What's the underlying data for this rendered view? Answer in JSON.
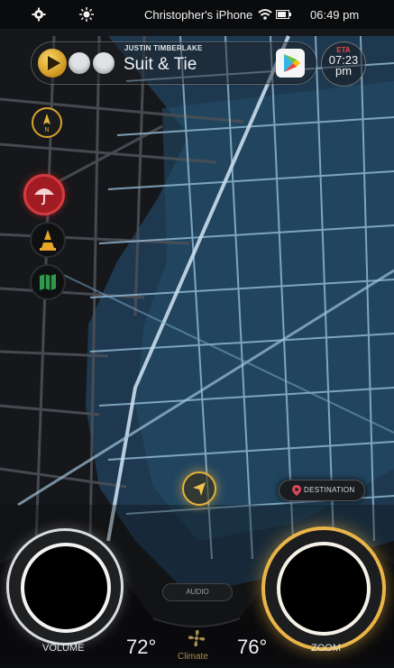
{
  "status_bar": {
    "device": "Christopher's iPhone",
    "time": "06:49 pm",
    "icons": [
      "gear-icon",
      "brightness-icon",
      "wifi-icon",
      "battery-icon"
    ]
  },
  "now_playing": {
    "artist": "JUSTIN TIMBERLAKE",
    "title": "Suit & Tie",
    "icons": [
      "play-icon",
      "google-play-icon"
    ]
  },
  "eta": {
    "label": "ETA",
    "time": "07:23",
    "ampm": "pm"
  },
  "side_controls": [
    "compass-icon",
    "umbrella-icon",
    "traffic-cone-icon",
    "map-icon"
  ],
  "map": {
    "destination_label": "DESTINATION",
    "marker": "navigation-arrow-icon"
  },
  "bottom_bar": {
    "volume_label": "VOLUME",
    "zoom_label": "ZOOM",
    "audio_label": "AUDIO",
    "temp_left": "72°",
    "temp_right": "76°",
    "climate_label": "Climate"
  },
  "colors": {
    "accent_gold": "#e2b53a",
    "accent_red": "#c2262d",
    "accent_green": "#2f9a4c",
    "water_blue": "#3a6e93"
  }
}
